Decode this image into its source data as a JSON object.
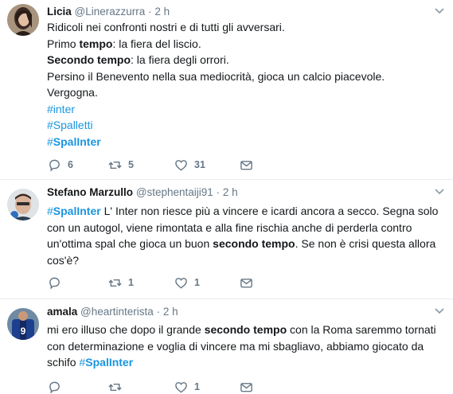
{
  "tweets": [
    {
      "name": "Licia",
      "handle": "@Linerazzurra",
      "sep": "·",
      "time": "2 h",
      "avatar_icon": "user-avatar-photo-licia",
      "lines": [
        [
          {
            "t": "Ridicoli nei confronti nostri e di tutti gli avversari."
          }
        ],
        [
          {
            "t": "Primo "
          },
          {
            "t": "tempo",
            "b": 1
          },
          {
            "t": ": la fiera del liscio."
          }
        ],
        [
          {
            "t": "Secondo tempo",
            "b": 1
          },
          {
            "t": ": la fiera degli orrori."
          }
        ],
        [
          {
            "t": "Persino il Benevento nella sua mediocrità, gioca un calcio piacevole."
          }
        ],
        [
          {
            "t": "Vergogna."
          }
        ],
        [
          {
            "t": "#inter",
            "tag": 1
          }
        ],
        [
          {
            "t": "#Spalletti",
            "tag": 1
          }
        ],
        [
          {
            "t": "#",
            "tag": 1
          },
          {
            "t": "SpalInter",
            "tag": 1,
            "b": 1
          }
        ]
      ],
      "replies": "6",
      "retweets": "5",
      "likes": "31"
    },
    {
      "name": "Stefano Marzullo",
      "handle": "@stephentaiji91",
      "sep": "·",
      "time": "2 h",
      "avatar_icon": "user-avatar-photo-stefano",
      "lines": [
        [
          {
            "t": "#",
            "tag": 1
          },
          {
            "t": "SpalInter",
            "tag": 1,
            "b": 1
          },
          {
            "t": " L' Inter non riesce più a vincere e icardi ancora a secco. Segna solo"
          }
        ],
        [
          {
            "t": "con un autogol, viene rimontata e alla fine rischia anche di perderla contro"
          }
        ],
        [
          {
            "t": "un'ottima spal che gioca un buon "
          },
          {
            "t": "secondo tempo",
            "b": 1
          },
          {
            "t": ". Se non è crisi questa allora"
          }
        ],
        [
          {
            "t": "cos'è?"
          }
        ]
      ],
      "replies": "",
      "retweets": "1",
      "likes": "1"
    },
    {
      "name": "amala",
      "handle": "@heartinterista",
      "sep": "·",
      "time": "2 h",
      "avatar_icon": "user-avatar-photo-amala",
      "lines": [
        [
          {
            "t": "mi ero illuso che dopo il grande "
          },
          {
            "t": "secondo tempo",
            "b": 1
          },
          {
            "t": " con la Roma saremmo tornati"
          }
        ],
        [
          {
            "t": "con determinazione e voglia di vincere ma mi sbagliavo, abbiamo giocato da"
          }
        ],
        [
          {
            "t": "schifo "
          },
          {
            "t": "#",
            "tag": 1
          },
          {
            "t": "SpalInter",
            "tag": 1,
            "b": 1
          }
        ]
      ],
      "replies": "",
      "retweets": "",
      "likes": "1"
    }
  ],
  "icons": {
    "reply": "reply-icon",
    "retweet": "retweet-icon",
    "like": "heart-icon",
    "dm": "direct-message-icon",
    "more": "chevron-down-icon"
  },
  "colors": {
    "text": "#14171a",
    "muted": "#657786",
    "link": "#1b95e0",
    "divider": "#e6ecf0"
  }
}
